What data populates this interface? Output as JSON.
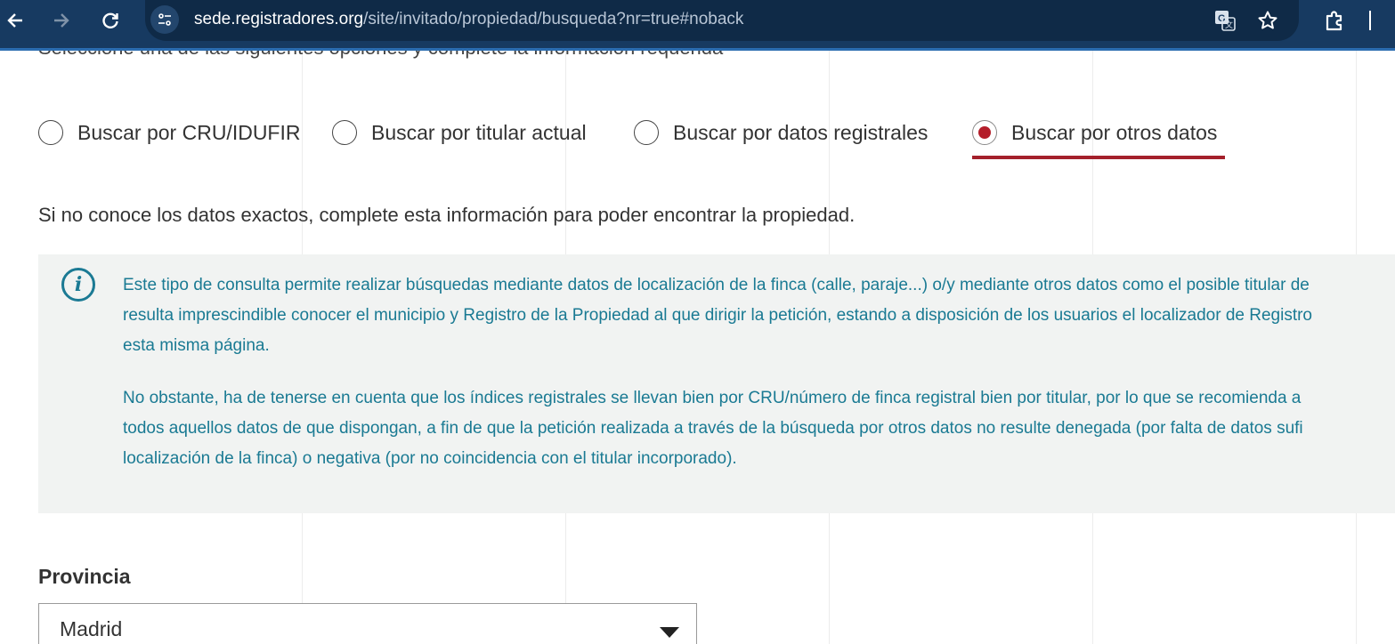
{
  "browser": {
    "url_host": "sede.registradores.org",
    "url_path": "/site/invitado/propiedad/busqueda?nr=true#noback",
    "icons": [
      "back-icon",
      "forward-icon",
      "reload-icon",
      "site-info-icon",
      "translate-icon",
      "bookmark-star-icon",
      "extensions-icon"
    ],
    "bar_color": "#173a61"
  },
  "page": {
    "cut_off_text": "Seleccione una de las siguientes opciones y complete la información requerida",
    "search_options": [
      {
        "label": "Buscar por CRU/IDUFIR",
        "selected": false
      },
      {
        "label": "Buscar por titular actual",
        "selected": false
      },
      {
        "label": "Buscar por datos registrales",
        "selected": false
      },
      {
        "label": "Buscar por otros datos",
        "selected": true
      }
    ],
    "intro": "Si no conoce los datos exactos, complete esta información para poder encontrar la propiedad.",
    "info_box": {
      "icon": "info-icon",
      "paragraph1": [
        "Este tipo de consulta permite realizar búsquedas mediante datos de localización de la finca (calle, paraje...) o/y mediante otros datos como el posible titular de",
        "resulta imprescindible conocer el municipio y Registro de la Propiedad al que dirigir la petición, estando a disposición de los usuarios el localizador de Registro",
        "esta misma página."
      ],
      "paragraph2": [
        "No obstante, ha de tenerse en cuenta que los índices registrales se llevan bien por CRU/número de finca registral bien por titular, por lo que se recomienda a",
        "todos aquellos datos de que dispongan, a fin de que la petición realizada a través de la búsqueda por otros datos no resulte denegada (por falta de datos sufi",
        "localización de la finca) o negativa (por no coincidencia con el titular incorporado)."
      ]
    },
    "provincia": {
      "label": "Provincia",
      "value": "Madrid"
    },
    "colors": {
      "accent_red": "#b41e2a",
      "info_text": "#1a7a93",
      "info_bg": "#f1f3f2"
    }
  }
}
